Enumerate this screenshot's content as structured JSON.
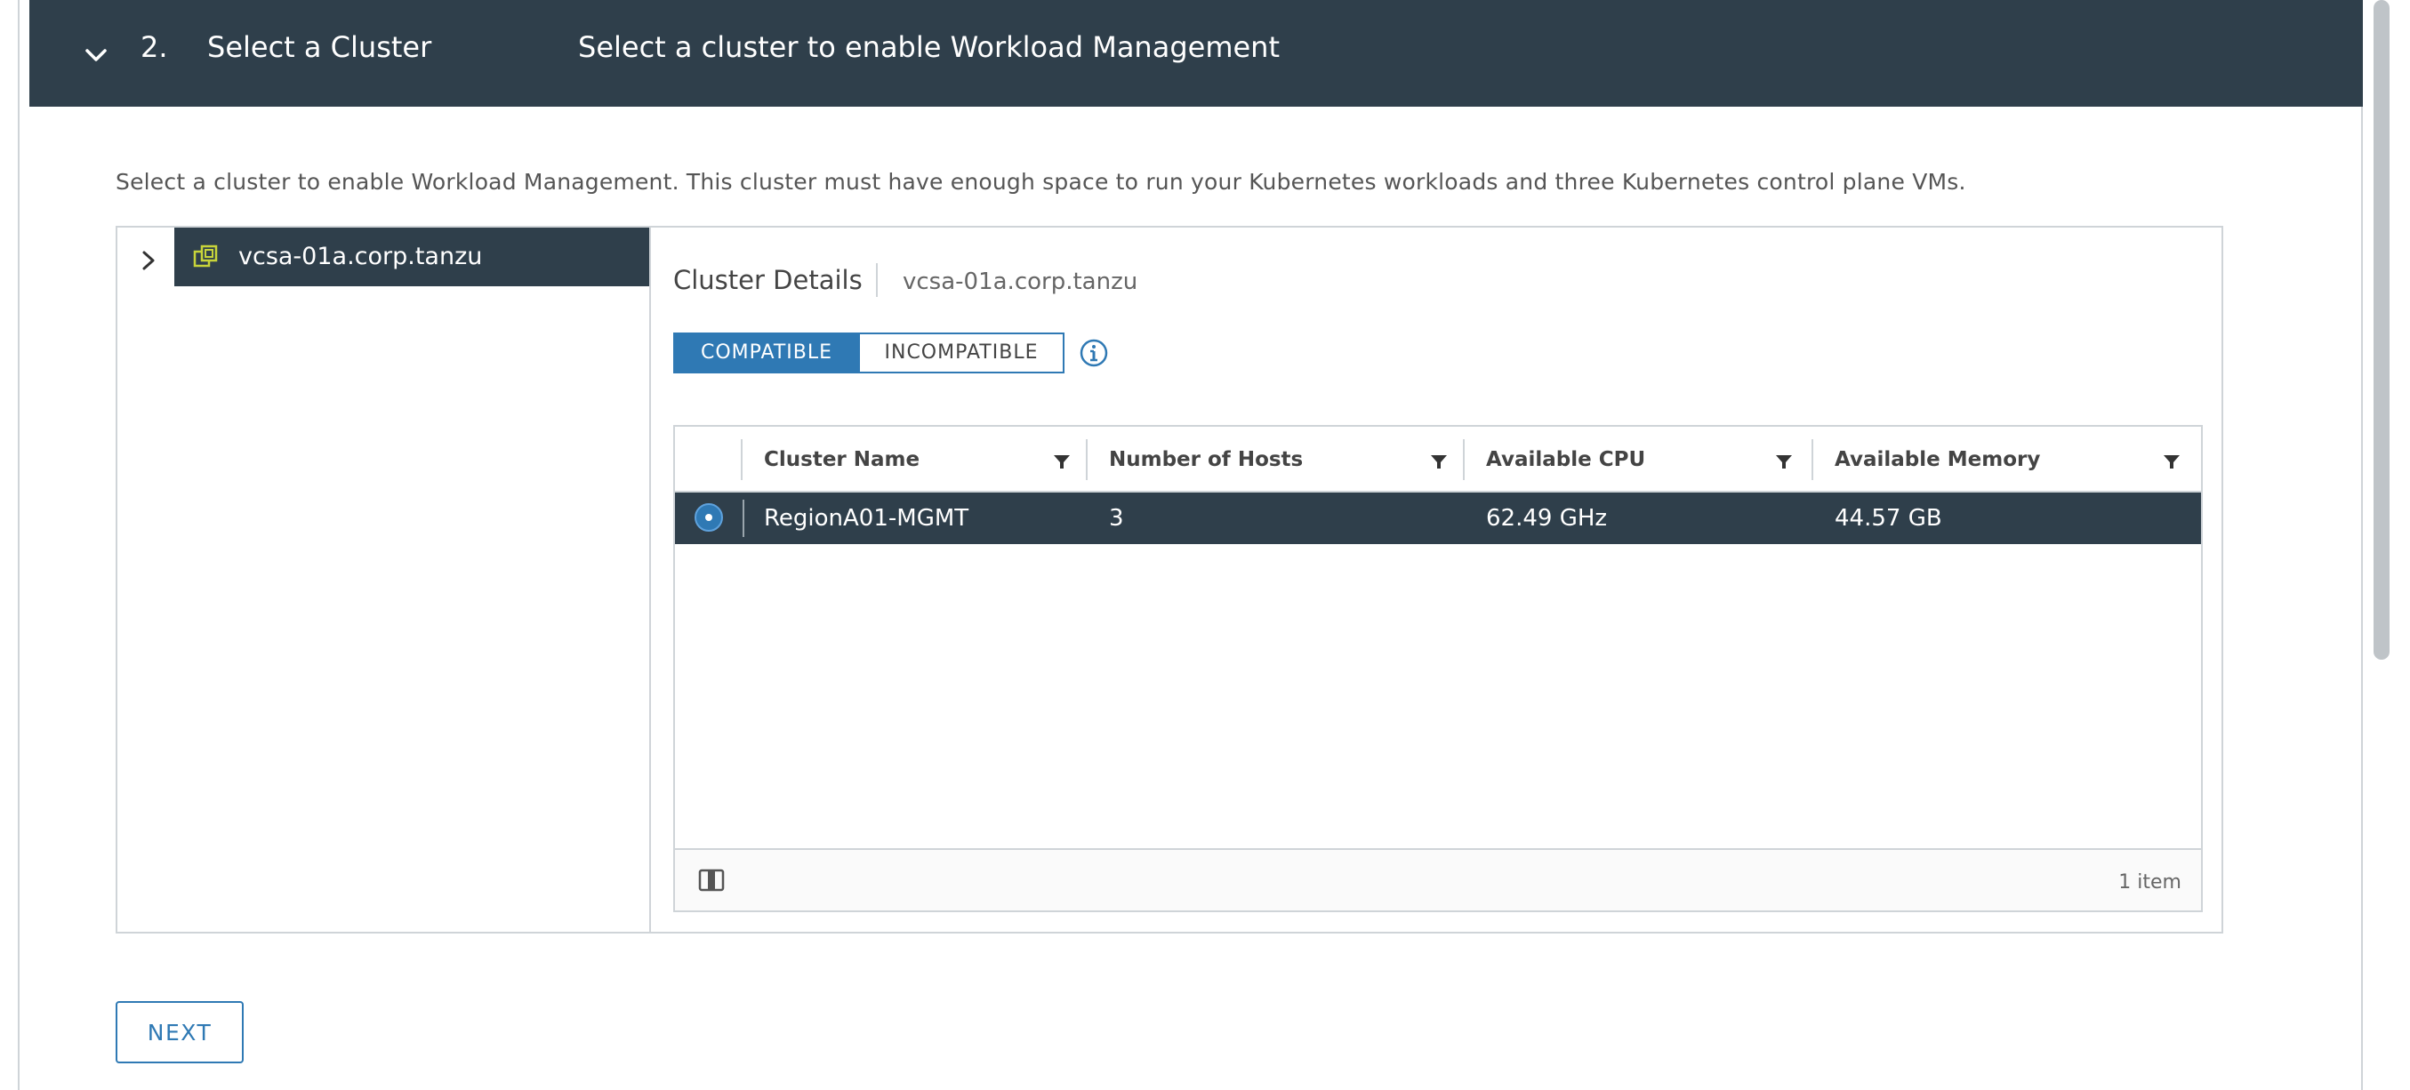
{
  "header": {
    "step_number": "2.",
    "step_title": "Select a Cluster",
    "step_description": "Select a cluster to enable Workload Management"
  },
  "intro_text": "Select a cluster to enable Workload Management. This cluster must have enough space to run your Kubernetes workloads and three Kubernetes control plane VMs.",
  "tree": {
    "node_label": "vcsa-01a.corp.tanzu",
    "node_icon": "datacenter-icon"
  },
  "details": {
    "title": "Cluster Details",
    "subtitle": "vcsa-01a.corp.tanzu",
    "toggle": {
      "compatible": "COMPATIBLE",
      "incompatible": "INCOMPATIBLE",
      "selected": "COMPATIBLE"
    },
    "grid": {
      "columns": [
        "Cluster Name",
        "Number of Hosts",
        "Available CPU",
        "Available Memory"
      ],
      "rows": [
        {
          "cluster_name": "RegionA01-MGMT",
          "hosts": "3",
          "cpu": "62.49 GHz",
          "memory": "44.57 GB",
          "selected": true
        }
      ],
      "footer_count": "1 item"
    }
  },
  "next_button": "NEXT",
  "colors": {
    "header_bg": "#2f3f4b",
    "accent": "#2f79b4",
    "selected_row_bg": "#2f3f4b"
  }
}
